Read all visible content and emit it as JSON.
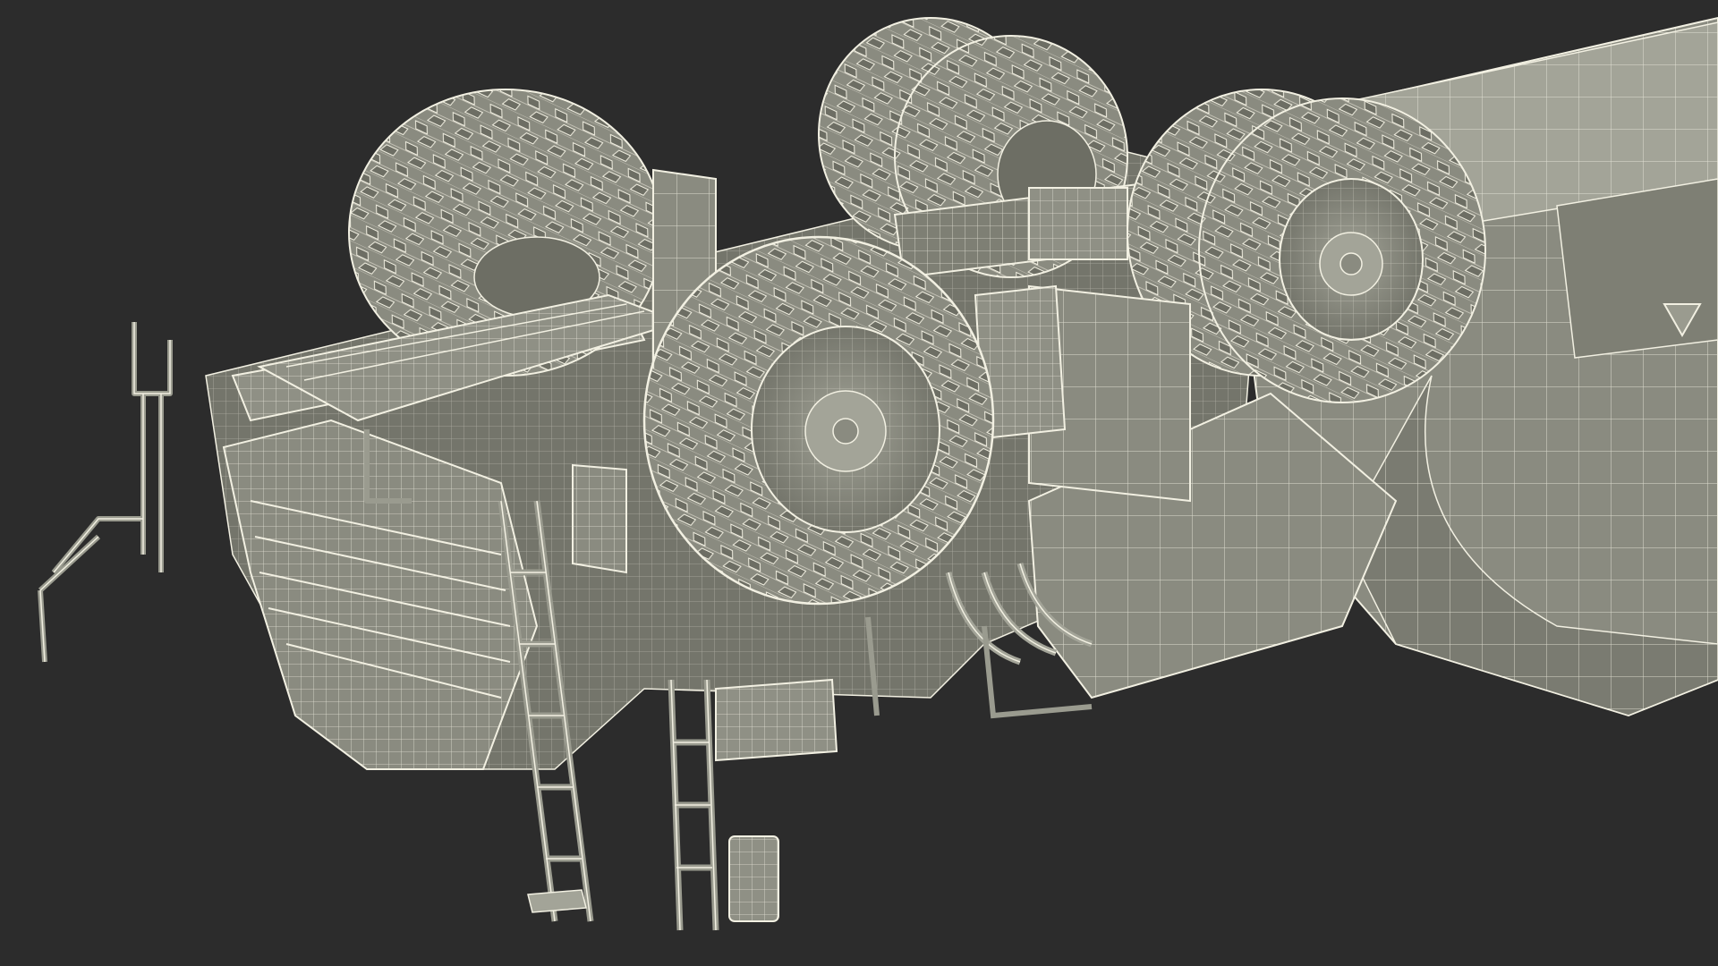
{
  "scene": {
    "subject": "dump-truck-underside-wireframe",
    "render_style": "wireframe-on-shaded",
    "colors": {
      "background": "#2c2c2c",
      "surface": "#8a8b80",
      "surface_light": "#a3a498",
      "surface_dark": "#6d6e64",
      "wire": "#f2f0e2",
      "tire_dark": "#5f605a",
      "shadow": "#3a3a36"
    },
    "components": [
      "front-left-tire",
      "front-right-tire",
      "rear-left-tire-pair",
      "rear-right-tire-pair",
      "chassis-frame",
      "dump-bed",
      "rear-axle",
      "cab-front-grille",
      "front-bumper-platform",
      "ladder-left",
      "ladder-right",
      "handrails",
      "mud-flaps",
      "fuel-tank",
      "exhaust-pipes"
    ]
  }
}
